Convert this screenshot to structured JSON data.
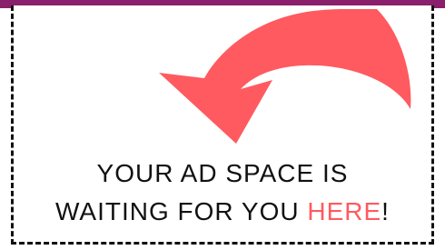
{
  "ad": {
    "headline_line1": "YOUR AD SPACE IS",
    "headline_line2_prefix": "WAITING FOR YOU ",
    "headline_line2_highlight": "HERE",
    "headline_line2_suffix": "!"
  },
  "colors": {
    "accent": "#ff5a5f",
    "border": "#111111",
    "top_strip": "#8a1f6c"
  },
  "icons": {
    "arrow": "curved-arrow-down-left-icon"
  }
}
